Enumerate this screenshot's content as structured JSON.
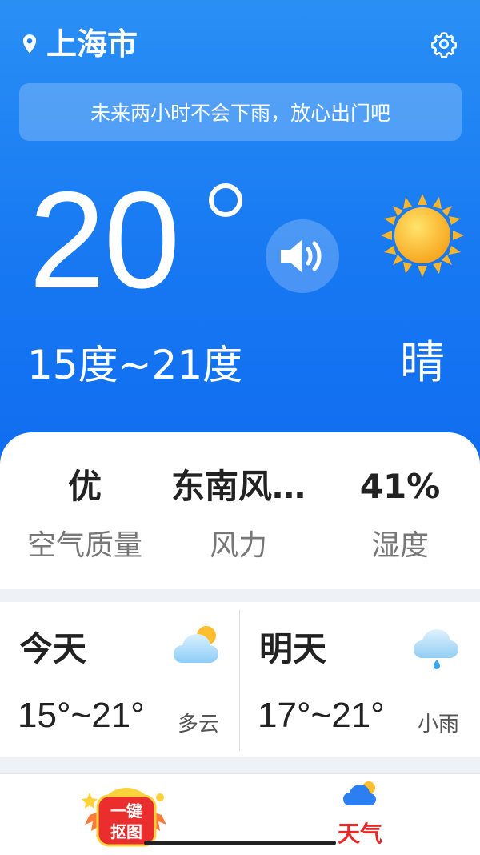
{
  "header": {
    "city": "上海市",
    "location_icon": "location-pin-icon",
    "settings_icon": "gear-icon"
  },
  "banner": {
    "text": "未来两小时不会下雨，放心出门吧"
  },
  "current": {
    "temperature": "20",
    "range": "15度~21度",
    "condition": "晴",
    "speaker_icon": "speaker-icon",
    "weather_icon": "sun-icon"
  },
  "stats": [
    {
      "value": "优",
      "label": "空气质量"
    },
    {
      "value": "东南风…",
      "label": "风力"
    },
    {
      "value": "41%",
      "label": "湿度"
    }
  ],
  "forecast": [
    {
      "day": "今天",
      "temps": "15°~21°",
      "condition": "多云",
      "icon": "cloudy-sun-icon"
    },
    {
      "day": "明天",
      "temps": "17°~21°",
      "condition": "小雨",
      "icon": "light-rain-icon"
    }
  ],
  "tabbar": {
    "tabs": [
      {
        "label": "一键抠图",
        "label_line1": "一键",
        "label_line2": "抠图",
        "icon": "cutout-badge-icon"
      },
      {
        "label": "天气",
        "icon": "weather-cloud-icon",
        "active": true
      }
    ],
    "active_color": "#e62a2a"
  },
  "colors": {
    "hero_top": "#2a8ff5",
    "hero_bottom": "#0f6cf0",
    "accent_red": "#e62a2a"
  }
}
